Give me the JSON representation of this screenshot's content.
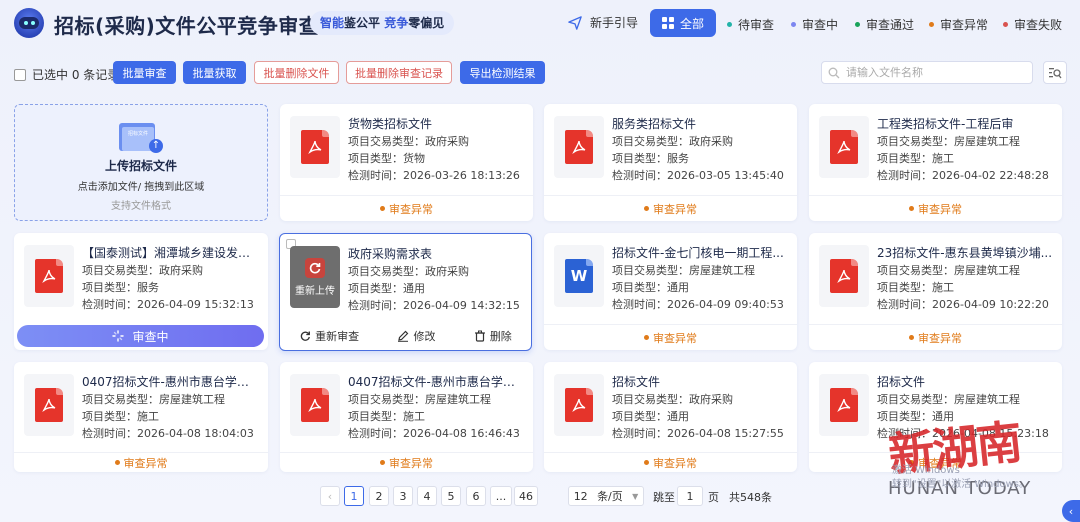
{
  "header": {
    "title": "招标(采购)文件公平竞争审查",
    "slogan_a": "智能",
    "slogan_b": "鉴公平",
    "slogan_c": "竞争",
    "slogan_d": "零偏见",
    "guide": "新手引导",
    "filters": [
      {
        "label": "全部",
        "color": "#3d6ae8"
      },
      {
        "label": "待审查",
        "color": "#22b3a8"
      },
      {
        "label": "审查中",
        "color": "#7c86f0"
      },
      {
        "label": "审查通过",
        "color": "#19a35a"
      },
      {
        "label": "审查异常",
        "color": "#e07b1a"
      },
      {
        "label": "审查失败",
        "color": "#d9534f"
      }
    ]
  },
  "toolbar": {
    "selected": "已选中 0 条记录",
    "batch_review": "批量审查",
    "batch_fetch": "批量获取",
    "batch_delete_files": "批量删除文件",
    "batch_delete_records": "批量删除审查记录",
    "export": "导出检测结果",
    "search_placeholder": "请输入文件名称"
  },
  "upload": {
    "folder_text": "招标文件",
    "title": "上传招标文件",
    "hint": "点击添加文件/ 拖拽到此区域",
    "sub": "支持文件格式"
  },
  "labels": {
    "trade_type": "项目交易类型：",
    "project_type": "项目类型：",
    "check_time": "检测时间：",
    "reupload": "重新上传",
    "re_review": "重新审查",
    "edit": "修改",
    "delete": "删除"
  },
  "cards": [
    {
      "name": "货物类招标文件",
      "trade": "政府采购",
      "type": "货物",
      "time": "2026-03-26 18:13:26",
      "status": "审查异常",
      "icon": "pdf"
    },
    {
      "name": "服务类招标文件",
      "trade": "政府采购",
      "type": "服务",
      "time": "2026-03-05 13:45:40",
      "status": "审查异常",
      "icon": "pdf"
    },
    {
      "name": "工程类招标文件-工程后审",
      "trade": "房屋建筑工程",
      "type": "施工",
      "time": "2026-04-02 22:48:28",
      "status": "审查异常",
      "icon": "pdf"
    },
    {
      "name": "【国泰测试】湘潭城乡建设发展...",
      "trade": "政府采购",
      "type": "服务",
      "time": "2026-04-09 15:32:13",
      "status": "审查中",
      "icon": "pdf"
    },
    {
      "name": "政府采购需求表",
      "trade": "政府采购",
      "type": "通用",
      "time": "2026-04-09 14:32:15",
      "status": "",
      "icon": "reupload"
    },
    {
      "name": "招标文件-金七门核电一期工程...",
      "trade": "房屋建筑工程",
      "type": "通用",
      "time": "2026-04-09 09:40:53",
      "status": "审查异常",
      "icon": "word"
    },
    {
      "name": "23招标文件-惠东县黄埠镇沙埔...",
      "trade": "房屋建筑工程",
      "type": "施工",
      "time": "2026-04-09 10:22:20",
      "status": "审查异常",
      "icon": "pdf"
    },
    {
      "name": "0407招标文件-惠州市惠台学校...",
      "trade": "房屋建筑工程",
      "type": "施工",
      "time": "2026-04-08 18:04:03",
      "status": "审查异常",
      "icon": "pdf"
    },
    {
      "name": "0407招标文件-惠州市惠台学校...",
      "trade": "房屋建筑工程",
      "type": "施工",
      "time": "2026-04-08 16:46:43",
      "status": "审查异常",
      "icon": "pdf"
    },
    {
      "name": "招标文件",
      "trade": "政府采购",
      "type": "通用",
      "time": "2026-04-08 15:27:55",
      "status": "审查异常",
      "icon": "pdf"
    },
    {
      "name": "招标文件",
      "trade": "房屋建筑工程",
      "type": "通用",
      "time": "2026-04-08 15:23:18",
      "status": "审查异常",
      "icon": "pdf"
    }
  ],
  "pagination": {
    "prev": "‹",
    "pages": [
      "1",
      "2",
      "3",
      "4",
      "5",
      "6",
      "...",
      "46"
    ],
    "page_size": "12",
    "page_size_unit": "条/页",
    "jump_label": "跳至",
    "jump_value": "1",
    "page_unit": "页",
    "total": "共548条"
  },
  "watermark": {
    "win_line1": "激活 Windows",
    "win_line2": "转到\"设置\"以激活 Windows。",
    "brand_cn": "新湖南",
    "brand_en": "HUNAN TODAY"
  }
}
